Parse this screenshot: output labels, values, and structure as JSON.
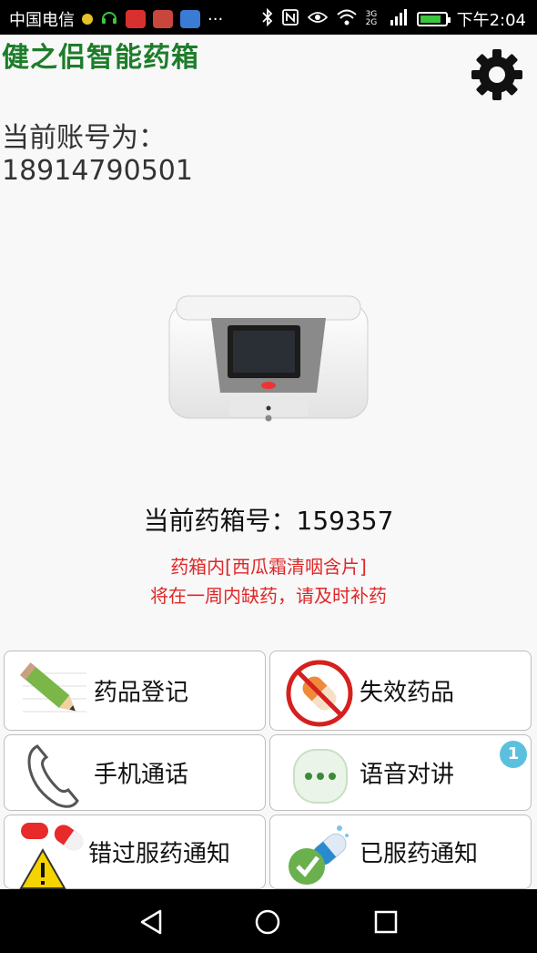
{
  "status_bar": {
    "carrier": "中国电信",
    "network_label": "3G 2G",
    "time": "下午2:04",
    "battery_level": 0.85
  },
  "header": {
    "title": "健之侣智能药箱",
    "settings_icon": "gear-icon"
  },
  "account": {
    "label": "当前账号为：",
    "number": "18914790501"
  },
  "medicine_box": {
    "id_text": "当前药箱号：159357",
    "alert_line1": "药箱内[西瓜霜清咽含片]",
    "alert_line2": "将在一周内缺药，请及时补药"
  },
  "menu": [
    {
      "label": "药品登记",
      "icon": "pencil-icon"
    },
    {
      "label": "失效药品",
      "icon": "no-pill-icon"
    },
    {
      "label": "手机通话",
      "icon": "phone-icon"
    },
    {
      "label": "语音对讲",
      "icon": "chat-bubble-icon",
      "badge": "1"
    },
    {
      "label": "错过服药通知",
      "icon": "warning-pill-icon"
    },
    {
      "label": "已服药通知",
      "icon": "check-pill-icon"
    }
  ],
  "colors": {
    "title_green": "#1d7d2a",
    "alert_red": "#e02727",
    "badge_blue": "#5bc0de"
  }
}
